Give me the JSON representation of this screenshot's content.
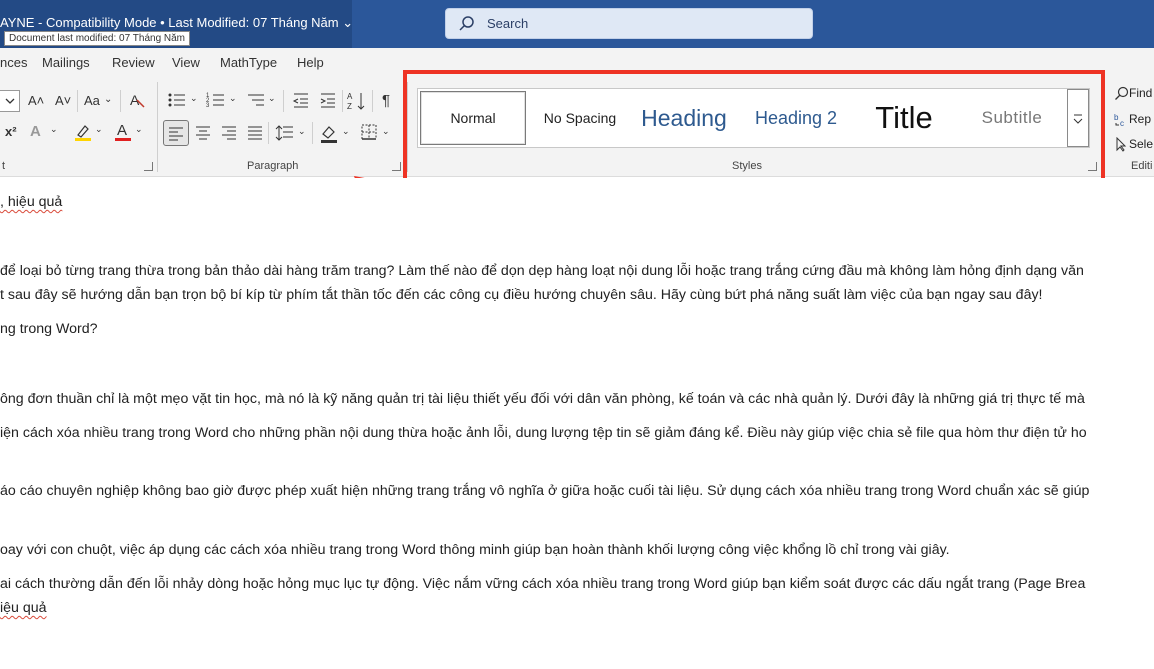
{
  "titlebar": {
    "title": "AYNE  -  Compatibility Mode  •  Last Modified: 07 Tháng Năm ⌄",
    "tooltip": "Document last modified: 07 Tháng Năm",
    "search_placeholder": "Search"
  },
  "menu": {
    "items": [
      "nces",
      "Mailings",
      "Review",
      "View",
      "MathType",
      "Help"
    ]
  },
  "ribbon": {
    "font_group_label": "t",
    "paragraph_label": "Paragraph",
    "styles_label": "Styles",
    "editing_label": "Editi",
    "styles": [
      "Normal",
      "No Spacing",
      "Heading",
      "Heading 2",
      "Title",
      "Subtitle"
    ],
    "find_label": "Find",
    "replace_label": "Rep",
    "select_label": "Sele",
    "font_glyphs": {
      "grow": "A˄",
      "shrink": "A˅",
      "case": "Aa",
      "superscript": "x²",
      "text_effects": "A",
      "font_color": "A"
    },
    "pilcrow": "¶",
    "sort": "A↓Z"
  },
  "document": {
    "lines": [
      ", hiệu quả",
      " để loại bỏ từng trang thừa trong bản thảo dài hàng trăm trang? Làm thế nào để dọn dẹp hàng loạt nội dung lỗi hoặc trang trắng cứng đầu mà không làm hỏng định dạng văn",
      "t sau đây sẽ hướng dẫn bạn trọn bộ bí kíp từ phím tắt thần tốc đến các công cụ điều hướng chuyên sâu. Hãy cùng bứt phá năng suất làm việc của bạn ngay sau đây!",
      "ng trong Word?",
      "ông đơn thuần chỉ là một mẹo vặt tin học, mà nó là kỹ năng quản trị tài liệu thiết yếu đối với dân văn phòng, kế toán và các nhà quản lý. Dưới đây là những giá trị thực tế mà",
      "iện cách xóa nhiều trang trong Word cho những phần nội dung thừa hoặc ảnh lỗi, dung lượng tệp tin sẽ giảm đáng kể. Điều này giúp việc chia sẻ file qua hòm thư điện tử ho",
      "áo cáo chuyên nghiệp không bao giờ được phép xuất hiện những trang trắng vô nghĩa ở giữa hoặc cuối tài liệu. Sử dụng cách xóa nhiều trang trong Word chuẩn xác sẽ giúp",
      "oay với con chuột, việc áp dụng các cách xóa nhiều trang trong Word thông minh giúp bạn hoàn thành khối lượng công việc khổng lồ chỉ trong vài giây.",
      "ai cách thường dẫn đến lỗi nhảy dòng hoặc hỏng mục lục tự động. Việc nắm vững cách xóa nhiều trang trong Word giúp bạn kiểm soát được các dấu ngắt trang (Page Brea",
      "iệu quả"
    ]
  },
  "colors": {
    "title_blue": "#2b579a",
    "ribbon_bg": "#f3f3f3",
    "annotation_red": "#ee3324"
  }
}
